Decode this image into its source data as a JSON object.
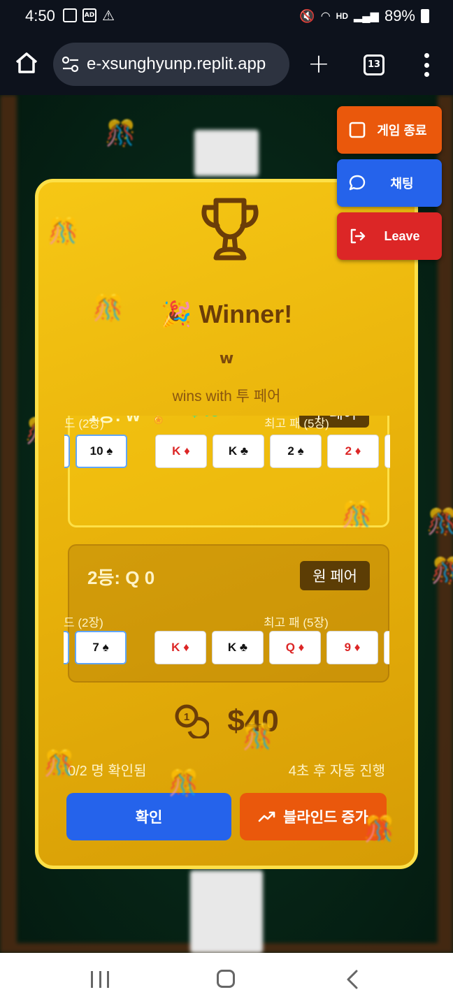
{
  "status_bar": {
    "time": "4:50",
    "battery": "89%",
    "network": "HD"
  },
  "browser": {
    "url": "e-xsunghyunp.replit.app",
    "tab_count": "13"
  },
  "floating_buttons": {
    "end_game": "게임 종료",
    "chat": "채팅",
    "leave": "Leave"
  },
  "modal": {
    "title": "Winner!",
    "title_emoji": "🎉",
    "winner_name": "w",
    "description": "wins with 투 페어",
    "results": [
      {
        "rank": "1등: w",
        "medal": "🏅",
        "winnings": "+$40",
        "hand": "투 페어",
        "hole_label": "드 (2장)",
        "best_label": "최고 패 (5장)",
        "hole_cards": [
          "10 ♠"
        ],
        "best_cards": [
          "K ♦",
          "K ♣",
          "2 ♠",
          "2 ♦"
        ]
      },
      {
        "rank": "2등: Q 0",
        "hand": "원 페어",
        "hole_label": "드 (2장)",
        "best_label": "최고 패 (5장)",
        "hole_cards": [
          "7 ♠"
        ],
        "best_cards": [
          "K ♦",
          "K ♣",
          "Q ♦",
          "9 ♦"
        ]
      }
    ],
    "pot": "$40",
    "confirm_count": "0/2 명 확인됨",
    "auto_next": "4초 후 자동 진행",
    "confirm_button": "확인",
    "blind_button": "블라인드 증가"
  },
  "colors": {
    "modal_gold": "#f6c715",
    "modal_border": "#fde047",
    "confirm_blue": "#2563eb",
    "blind_orange": "#ea580c",
    "leave_red": "#dc2626",
    "winnings_green": "#4ade80",
    "table_green": "#062416"
  }
}
